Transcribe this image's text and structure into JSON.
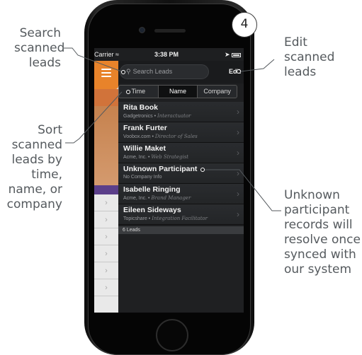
{
  "badge": "4",
  "callouts": {
    "search": [
      "Search",
      "scanned",
      "leads"
    ],
    "sort": [
      "Sort",
      "scanned",
      "leads by",
      "time,",
      "name, or",
      "company"
    ],
    "edit": [
      "Edit",
      "scanned",
      "leads"
    ],
    "unknown": [
      "Unknown",
      "participant",
      "records will",
      "resolve once",
      "synced with",
      "our system"
    ]
  },
  "statusbar": {
    "carrier": "Carrier",
    "time": "3:38 PM"
  },
  "search": {
    "placeholder": "Search Leads"
  },
  "edit_label": "Edit",
  "segments": [
    "Time",
    "Name",
    "Company"
  ],
  "active_segment": "Name",
  "leads": [
    {
      "name": "Rita Book",
      "company": "Gadgetronics",
      "title": "Interactuator"
    },
    {
      "name": "Frank Furter",
      "company": "Voobox.com",
      "title": "Director of Sales"
    },
    {
      "name": "Willie Maket",
      "company": "Acme, Inc.",
      "title": "Web Strategist"
    },
    {
      "name": "Unknown Participant",
      "company": "No Company Info",
      "title": ""
    },
    {
      "name": "Isabelle Ringing",
      "company": "Acme, Inc.",
      "title": "Brand Manager"
    },
    {
      "name": "Eileen Sideways",
      "company": "Topicshare",
      "title": "Integration Facilitator"
    }
  ],
  "lead_count": "6 Leads",
  "colors": {
    "accent": "#e8832a",
    "callout_text": "#555a5e",
    "screen_bg": "#1e1f21"
  }
}
